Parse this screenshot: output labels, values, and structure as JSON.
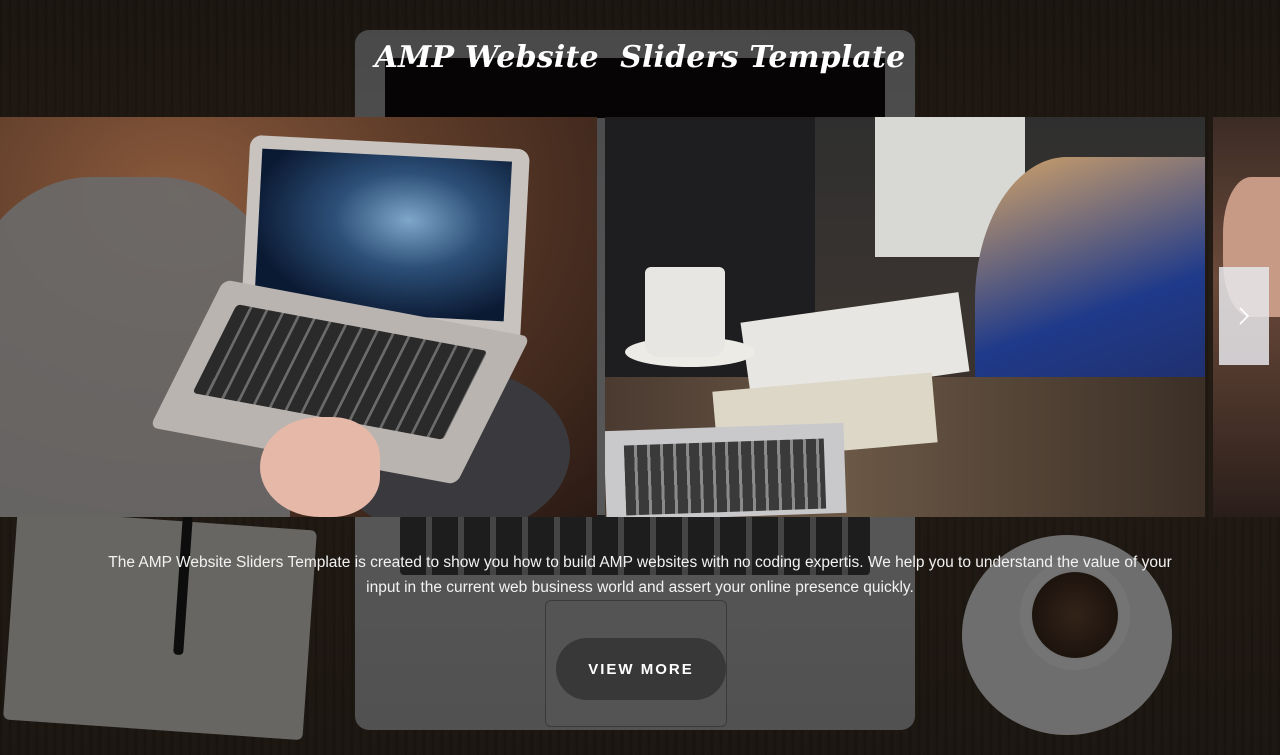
{
  "header": {
    "title": "AMP Website  Sliders Template"
  },
  "slider": {
    "slides": [
      {
        "alt": "Person typing on a laptop"
      },
      {
        "alt": "Team working at a table with notebooks and laptop"
      },
      {
        "alt": "Partially visible next slide"
      }
    ],
    "next_icon": "chevron-right-icon"
  },
  "content": {
    "description": "The AMP Website Sliders Template is created to show you how to build AMP websites with no coding expertis. We help you to understand the value of your input in the current web business world and assert your online presence quickly.",
    "button_label": "VIEW MORE"
  },
  "colors": {
    "button_bg": "#383838",
    "text": "#ffffff",
    "nav_bg": "#e6e6eb"
  }
}
